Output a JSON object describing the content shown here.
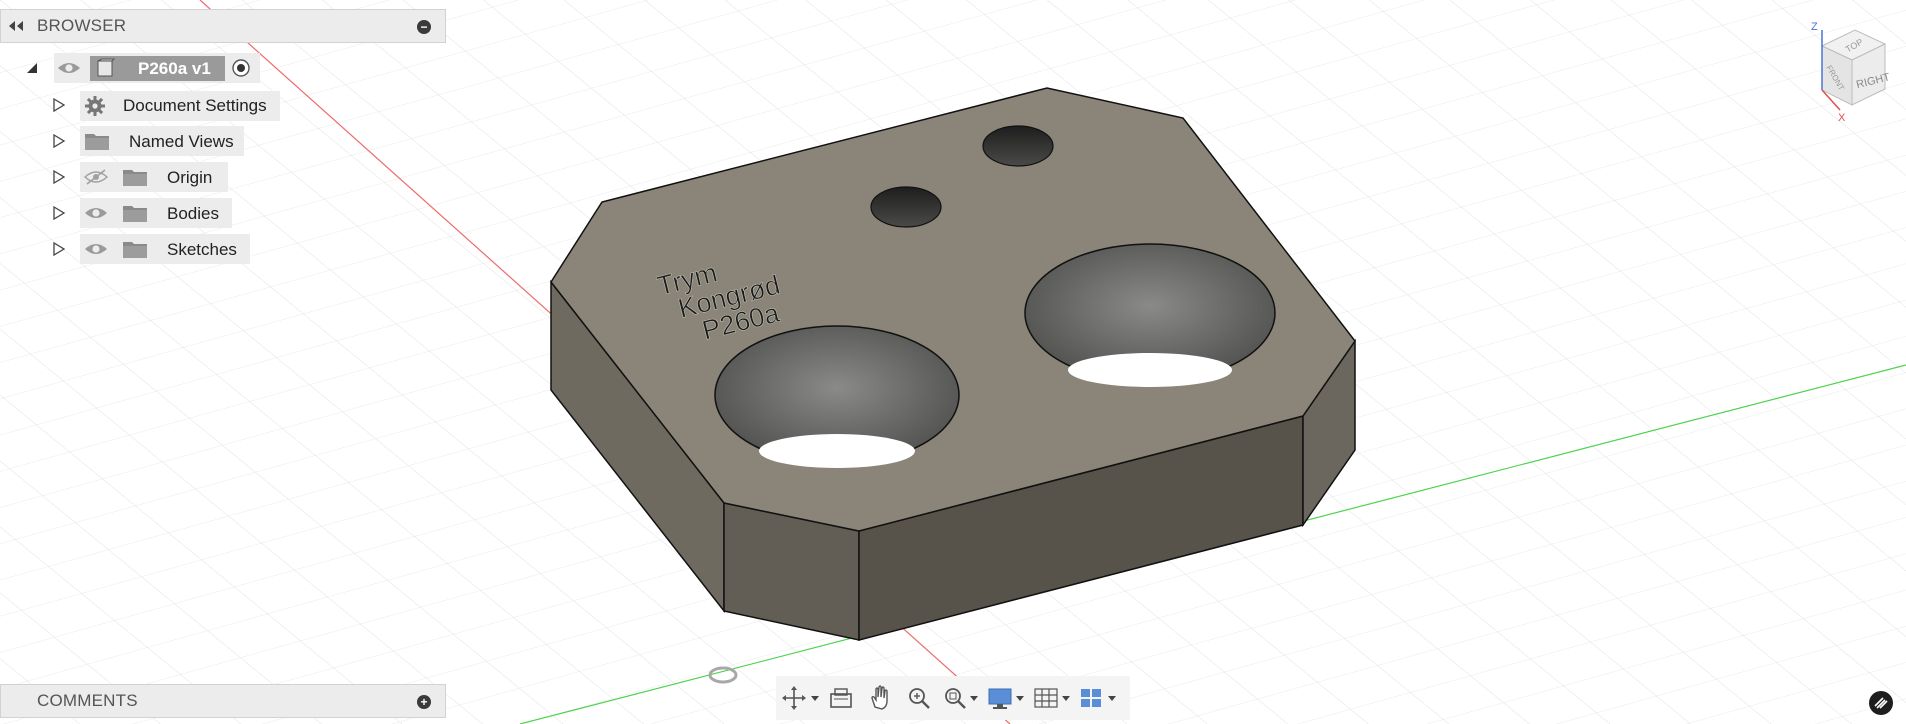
{
  "browser": {
    "title": "BROWSER",
    "root": {
      "label": "P260a v1"
    },
    "items": [
      {
        "label": "Document Settings",
        "icon": "gear-icon"
      },
      {
        "label": "Named Views",
        "icon": "folder-icon"
      },
      {
        "label": "Origin",
        "icon": "folder-icon",
        "visibility": "hidden"
      },
      {
        "label": "Bodies",
        "icon": "folder-icon",
        "visibility": "visible"
      },
      {
        "label": "Sketches",
        "icon": "folder-icon",
        "visibility": "visible"
      }
    ]
  },
  "comments": {
    "title": "COMMENTS"
  },
  "model": {
    "engraving": [
      "Trym",
      "Kongrød",
      "P260a"
    ]
  },
  "viewcube": {
    "axis_labels": {
      "z": "Z",
      "x": "X"
    },
    "faces": {
      "top": "TOP",
      "front": "FRONT",
      "right": "RIGHT"
    }
  },
  "toolbar": {
    "items": [
      "orbit-icon",
      "look-at-icon",
      "pan-icon",
      "zoom-icon",
      "fit-icon",
      "display-settings-icon",
      "grid-settings-icon",
      "viewports-icon"
    ]
  },
  "colors": {
    "grid": "#dcdcdc",
    "axis_red": "#f06a6a",
    "axis_green": "#4fd24f",
    "body_top": "#8a8578",
    "body_side_left": "#6e6a60",
    "body_side_front": "#57534a"
  }
}
